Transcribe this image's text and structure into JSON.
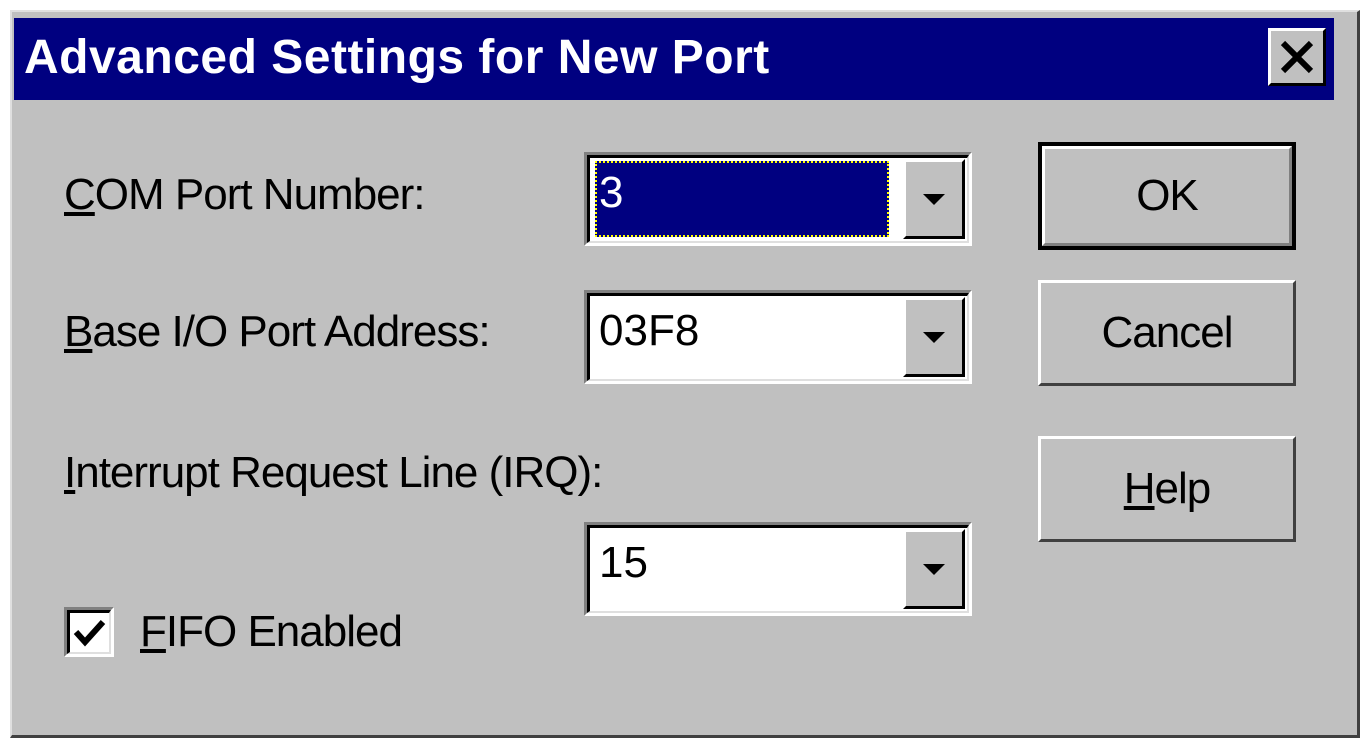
{
  "window": {
    "title": "Advanced Settings for New Port",
    "close_icon": "close-icon"
  },
  "fields": {
    "com_port": {
      "label_accel": "C",
      "label_rest": "OM Port Number:",
      "value": "3"
    },
    "base_io": {
      "label_accel": "B",
      "label_rest": "ase I/O Port Address:",
      "value": "03F8"
    },
    "irq": {
      "label_accel": "I",
      "label_rest": "nterrupt Request Line (IRQ):",
      "value": "15"
    },
    "fifo": {
      "label_accel": "F",
      "label_rest": "IFO Enabled",
      "checked": true
    }
  },
  "buttons": {
    "ok": "OK",
    "cancel": "Cancel",
    "help_accel": "H",
    "help_rest": "elp"
  },
  "colors": {
    "titlebar": "#000080",
    "face": "#c0c0c0",
    "selection": "#000080"
  }
}
